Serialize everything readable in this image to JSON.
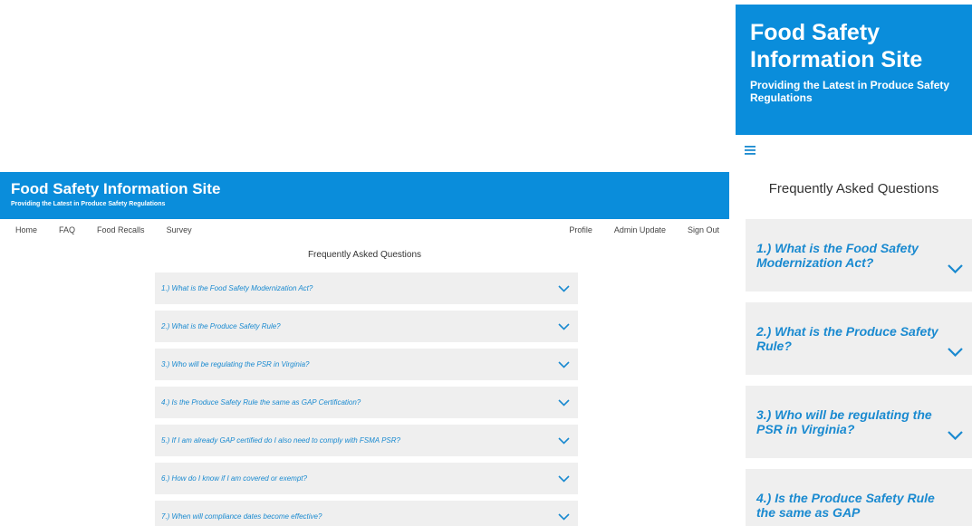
{
  "desktop": {
    "banner": {
      "title": "Food Safety Information Site",
      "subtitle": "Providing the Latest in Produce Safety Regulations"
    },
    "nav": {
      "left": [
        "Home",
        "FAQ",
        "Food Recalls",
        "Survey"
      ],
      "right": [
        "Profile",
        "Admin Update",
        "Sign Out"
      ]
    },
    "heading": "Frequently Asked Questions",
    "faqs": [
      "1.) What is the Food Safety Modernization Act?",
      "2.) What is the Produce Safety Rule?",
      "3.) Who will be regulating the PSR in Virginia?",
      "4.) Is the Produce Safety Rule the same as GAP Certification?",
      "5.) If I am already GAP certified do I also need to comply with FSMA PSR?",
      "6.) How do I know if I am covered or exempt?",
      "7.) When will compliance dates become effective?"
    ]
  },
  "mobile": {
    "banner": {
      "title": "Food Safety Information Site",
      "subtitle": "Providing the Latest in Produce Safety Regulations"
    },
    "menu_icon": "hamburger-menu-icon",
    "heading": "Frequently Asked Questions",
    "faqs": [
      "1.) What is the Food Safety Modernization Act?",
      "2.) What is the Produce Safety Rule?",
      "3.) Who will be regulating the PSR in Virginia?",
      "4.) Is the Produce Safety Rule the same as GAP"
    ]
  },
  "colors": {
    "banner": "#0a8ddb",
    "question_text": "#1a8ad0",
    "faq_background": "#efefef"
  }
}
